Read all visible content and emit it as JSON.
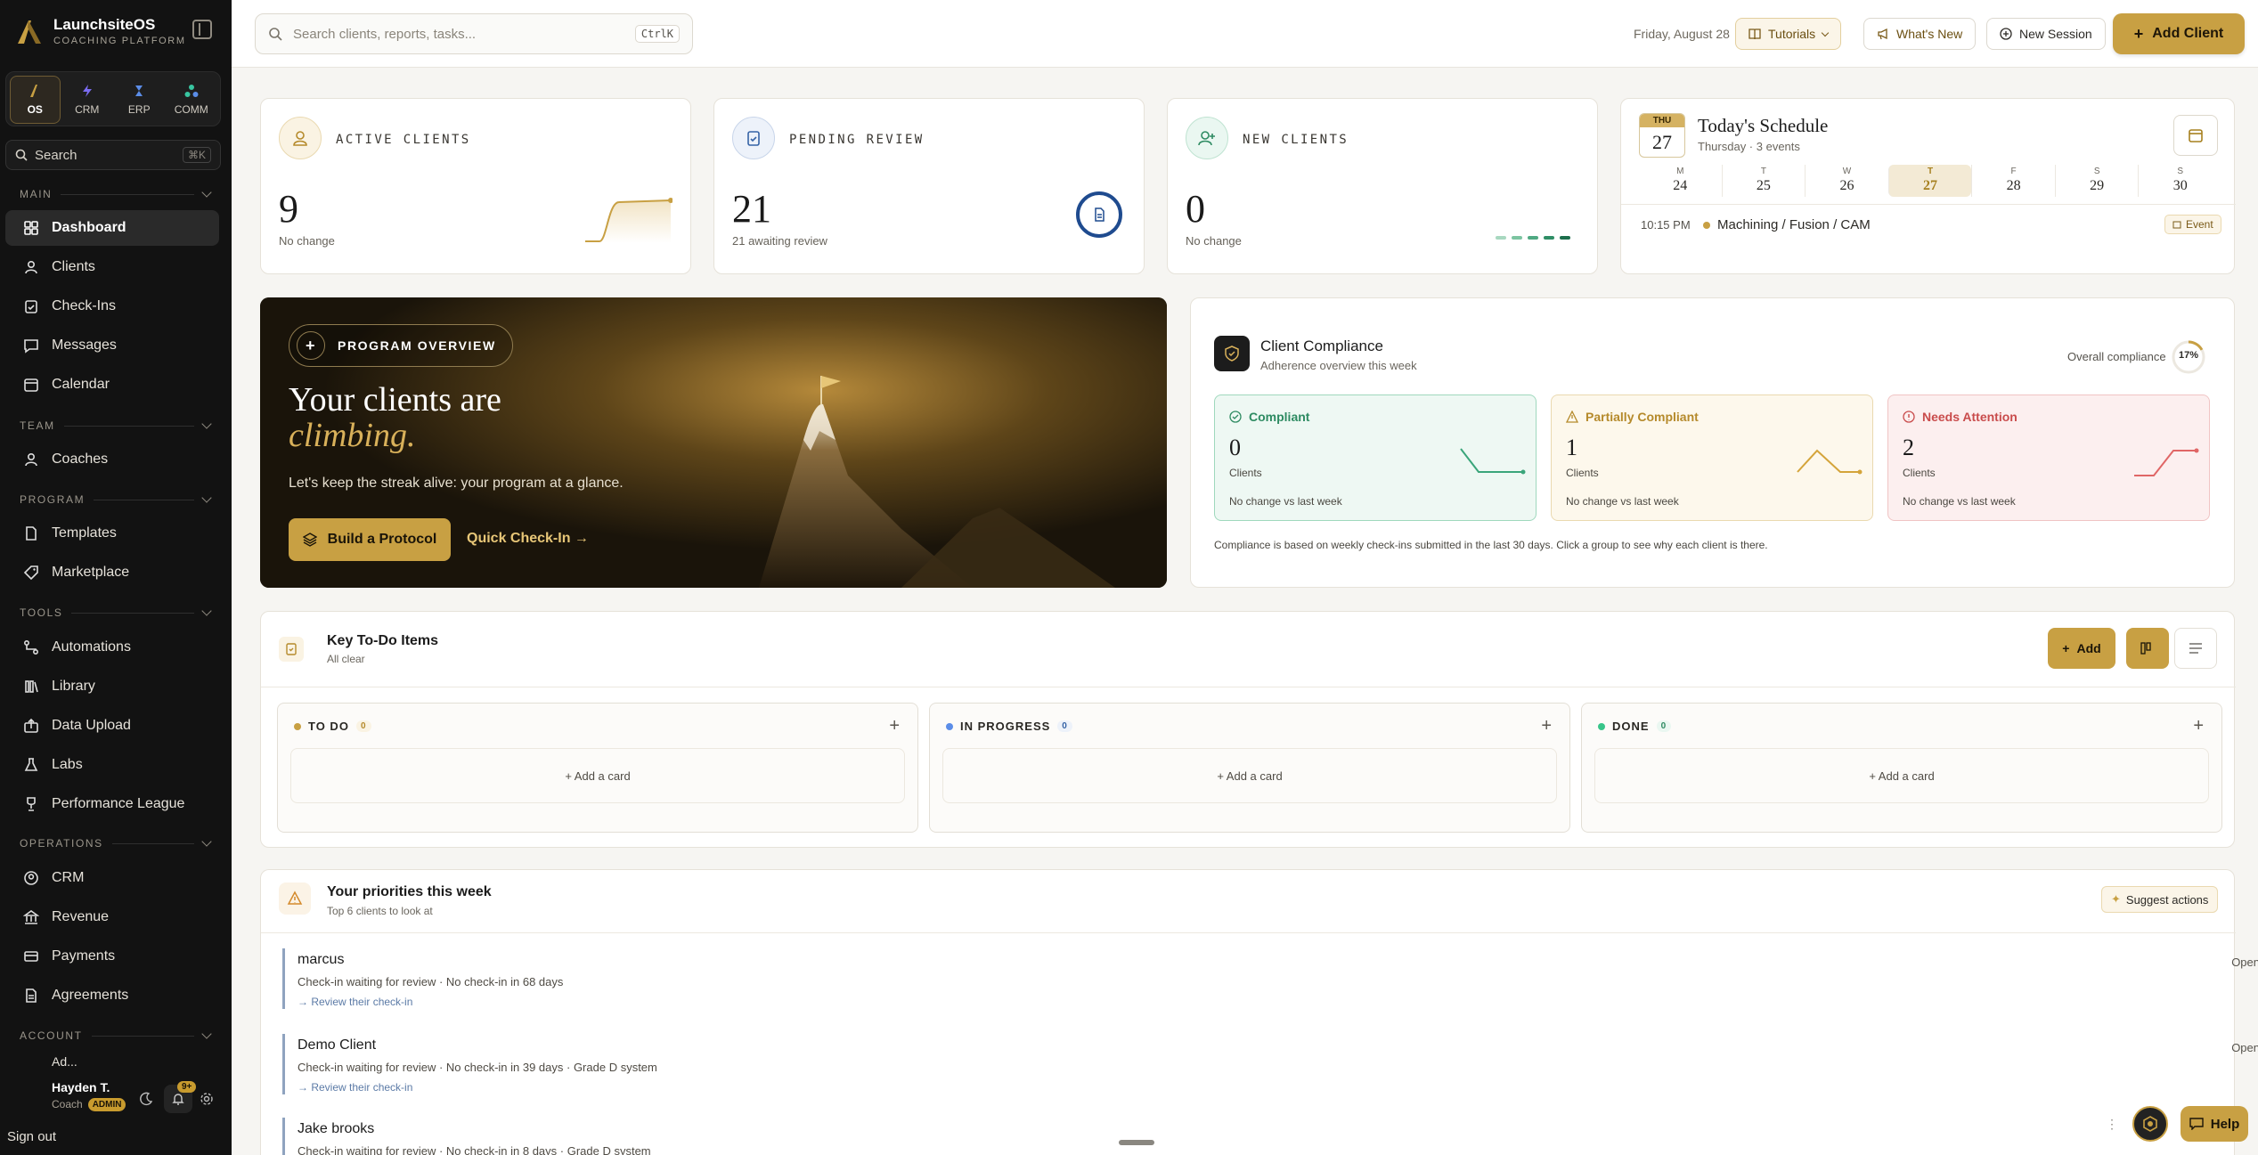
{
  "brand": {
    "name": "LaunchsiteOS",
    "subtitle": "COACHING PLATFORM"
  },
  "apps": [
    {
      "label": "OS",
      "active": true
    },
    {
      "label": "CRM"
    },
    {
      "label": "ERP"
    },
    {
      "label": "COMM"
    }
  ],
  "sidebar_search": {
    "label": "Search",
    "shortcut": "⌘K"
  },
  "sections": {
    "main": "MAIN",
    "team": "TEAM",
    "program": "PROGRAM",
    "tools": "TOOLS",
    "operations": "OPERATIONS",
    "account": "ACCOUNT"
  },
  "nav": {
    "dashboard": "Dashboard",
    "clients": "Clients",
    "checkins": "Check-Ins",
    "messages": "Messages",
    "calendar": "Calendar",
    "coaches": "Coaches",
    "templates": "Templates",
    "marketplace": "Marketplace",
    "automations": "Automations",
    "library": "Library",
    "data_upload": "Data Upload",
    "labs": "Labs",
    "performance_league": "Performance League",
    "crm": "CRM",
    "revenue": "Revenue",
    "payments": "Payments",
    "agreements": "Agreements",
    "account_partial": "Ad..."
  },
  "user": {
    "name": "Hayden T.",
    "role": "Coach",
    "badge": "ADMIN",
    "notifications": "9+"
  },
  "signout": "Sign out",
  "topbar": {
    "search_placeholder": "Search clients, reports, tasks...",
    "search_kbd": "CtrlK",
    "date": "Friday, August 28",
    "tutorials": "Tutorials",
    "whats_new": "What's New",
    "new_session": "New Session",
    "add_client": "Add Client"
  },
  "stats": {
    "active": {
      "label": "ACTIVE CLIENTS",
      "value": "9",
      "sub": "No change"
    },
    "pending": {
      "label": "PENDING REVIEW",
      "value": "21",
      "sub": "21 awaiting review"
    },
    "new": {
      "label": "NEW CLIENTS",
      "value": "0",
      "sub": "No change"
    }
  },
  "schedule": {
    "badge_day": "THU",
    "badge_num": "27",
    "title": "Today's Schedule",
    "subtitle": "Thursday · 3 events",
    "week": [
      {
        "l": "M",
        "n": "24"
      },
      {
        "l": "T",
        "n": "25"
      },
      {
        "l": "W",
        "n": "26"
      },
      {
        "l": "T",
        "n": "27",
        "today": true
      },
      {
        "l": "F",
        "n": "28"
      },
      {
        "l": "S",
        "n": "29"
      },
      {
        "l": "S",
        "n": "30"
      }
    ],
    "event": {
      "time": "10:15 PM",
      "title": "Machining / Fusion / CAM",
      "tag": "Event"
    }
  },
  "hero": {
    "tag": "PROGRAM OVERVIEW",
    "h1": "Your clients are",
    "h1b": "climbing.",
    "p": "Let's keep the streak alive: your program at a glance.",
    "cta": "Build a Protocol",
    "link": "Quick Check-In →"
  },
  "compliance": {
    "title": "Client Compliance",
    "subtitle": "Adherence overview this week",
    "overall_label": "Overall compliance",
    "overall": "17%",
    "overall_fraction": 0.17,
    "groups": [
      {
        "title": "Compliant",
        "count": "0",
        "unit": "Clients",
        "note": "No change vs last week"
      },
      {
        "title": "Partially Compliant",
        "count": "1",
        "unit": "Clients",
        "note": "No change vs last week"
      },
      {
        "title": "Needs Attention",
        "count": "2",
        "unit": "Clients",
        "note": "No change vs last week"
      }
    ],
    "footnote": "Compliance is based on weekly check-ins submitted in the last 30 days. Click a group to see why each client is there."
  },
  "todo": {
    "title": "Key To-Do Items",
    "subtitle": "All clear",
    "add": "Add",
    "columns": [
      {
        "name": "TO DO",
        "count": "0",
        "add": "+ Add a card"
      },
      {
        "name": "IN PROGRESS",
        "count": "0",
        "add": "+ Add a card"
      },
      {
        "name": "DONE",
        "count": "0",
        "add": "+ Add a card"
      }
    ]
  },
  "priorities": {
    "title": "Your priorities this week",
    "subtitle": "Top 6 clients to look at",
    "suggest": "Suggest actions",
    "items": [
      {
        "name": "marcus",
        "desc": "Check-in waiting for review · No check-in in 68 days",
        "link": "→ Review their check-in",
        "open": "Open"
      },
      {
        "name": "Demo Client",
        "desc": "Check-in waiting for review · No check-in in 39 days · Grade D system",
        "link": "→ Review their check-in",
        "open": "Open"
      },
      {
        "name": "Jake brooks",
        "desc": "Check-in waiting for review · No check-in in 8 days · Grade D system",
        "link": "",
        "open": ""
      }
    ]
  },
  "help": "Help"
}
